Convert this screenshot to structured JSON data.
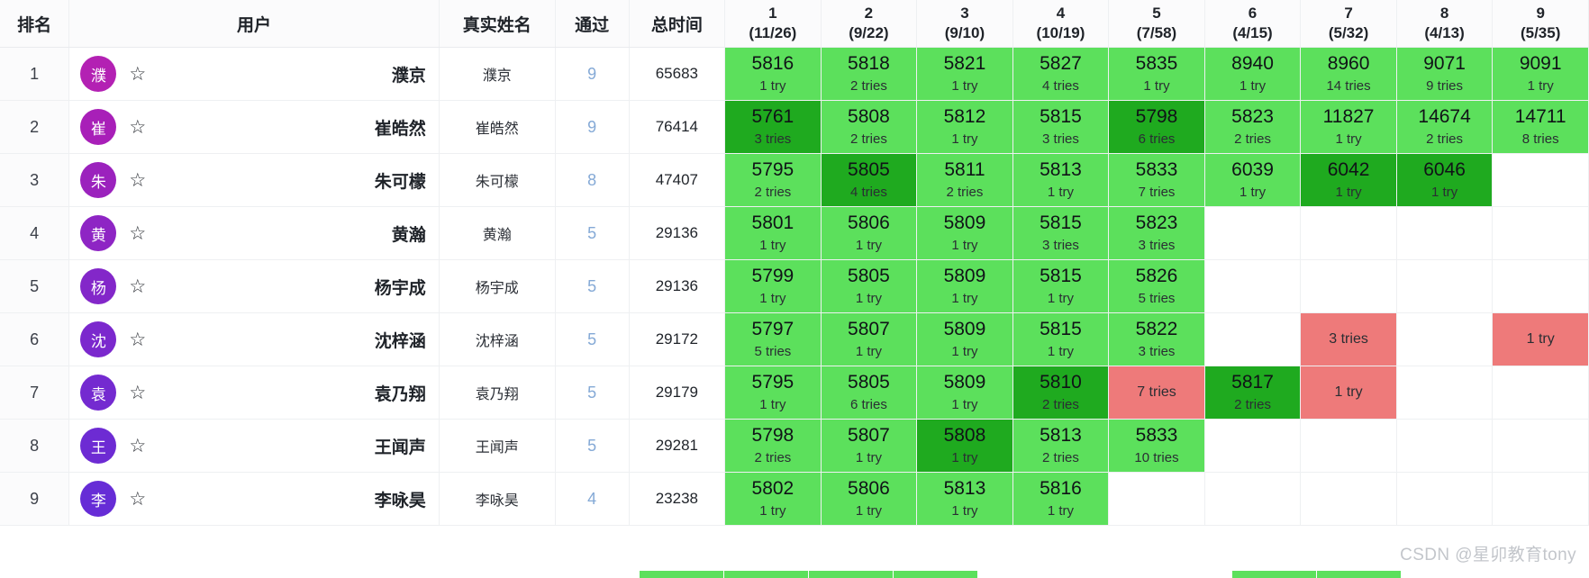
{
  "table": {
    "headers": {
      "rank": "排名",
      "user": "用户",
      "realname": "真实姓名",
      "pass": "通过",
      "total_time": "总时间"
    },
    "problems": [
      {
        "index": "1",
        "ratio": "(11/26)"
      },
      {
        "index": "2",
        "ratio": "(9/22)"
      },
      {
        "index": "3",
        "ratio": "(9/10)"
      },
      {
        "index": "4",
        "ratio": "(10/19)"
      },
      {
        "index": "5",
        "ratio": "(7/58)"
      },
      {
        "index": "6",
        "ratio": "(4/15)"
      },
      {
        "index": "7",
        "ratio": "(5/32)"
      },
      {
        "index": "8",
        "ratio": "(4/13)"
      },
      {
        "index": "9",
        "ratio": "(5/35)"
      }
    ],
    "rows": [
      {
        "rank": "1",
        "avatar_letter": "濮",
        "avatar_color": "#b321b3",
        "username": "濮京",
        "realname": "濮京",
        "pass": "9",
        "total_time": "65683",
        "cells": [
          {
            "state": "solved-first",
            "time": "5816",
            "tries": "1 try"
          },
          {
            "state": "solved-first",
            "time": "5818",
            "tries": "2 tries"
          },
          {
            "state": "solved-first",
            "time": "5821",
            "tries": "1 try"
          },
          {
            "state": "solved-first",
            "time": "5827",
            "tries": "4 tries"
          },
          {
            "state": "solved-first",
            "time": "5835",
            "tries": "1 try"
          },
          {
            "state": "solved-first",
            "time": "8940",
            "tries": "1 try"
          },
          {
            "state": "solved-first",
            "time": "8960",
            "tries": "14 tries"
          },
          {
            "state": "solved-first",
            "time": "9071",
            "tries": "9 tries"
          },
          {
            "state": "solved-first",
            "time": "9091",
            "tries": "1 try"
          }
        ]
      },
      {
        "rank": "2",
        "avatar_letter": "崔",
        "avatar_color": "#a81fb8",
        "username": "崔皓然",
        "realname": "崔皓然",
        "pass": "9",
        "total_time": "76414",
        "cells": [
          {
            "state": "solved-best",
            "time": "5761",
            "tries": "3 tries"
          },
          {
            "state": "solved-first",
            "time": "5808",
            "tries": "2 tries"
          },
          {
            "state": "solved-first",
            "time": "5812",
            "tries": "1 try"
          },
          {
            "state": "solved-first",
            "time": "5815",
            "tries": "3 tries"
          },
          {
            "state": "solved-best",
            "time": "5798",
            "tries": "6 tries"
          },
          {
            "state": "solved-first",
            "time": "5823",
            "tries": "2 tries"
          },
          {
            "state": "solved-first",
            "time": "11827",
            "tries": "1 try"
          },
          {
            "state": "solved-first",
            "time": "14674",
            "tries": "2 tries"
          },
          {
            "state": "solved-first",
            "time": "14711",
            "tries": "8 tries"
          }
        ]
      },
      {
        "rank": "3",
        "avatar_letter": "朱",
        "avatar_color": "#9b22bd",
        "username": "朱可檬",
        "realname": "朱可檬",
        "pass": "8",
        "total_time": "47407",
        "cells": [
          {
            "state": "solved-first",
            "time": "5795",
            "tries": "2 tries"
          },
          {
            "state": "solved-best",
            "time": "5805",
            "tries": "4 tries"
          },
          {
            "state": "solved-first",
            "time": "5811",
            "tries": "2 tries"
          },
          {
            "state": "solved-first",
            "time": "5813",
            "tries": "1 try"
          },
          {
            "state": "solved-first",
            "time": "5833",
            "tries": "7 tries"
          },
          {
            "state": "solved-first",
            "time": "6039",
            "tries": "1 try"
          },
          {
            "state": "solved-best",
            "time": "6042",
            "tries": "1 try"
          },
          {
            "state": "solved-best",
            "time": "6046",
            "tries": "1 try"
          },
          {
            "state": "empty",
            "time": "",
            "tries": ""
          }
        ]
      },
      {
        "rank": "4",
        "avatar_letter": "黄",
        "avatar_color": "#8e25c4",
        "username": "黄瀚",
        "realname": "黄瀚",
        "pass": "5",
        "total_time": "29136",
        "cells": [
          {
            "state": "solved-first",
            "time": "5801",
            "tries": "1 try"
          },
          {
            "state": "solved-first",
            "time": "5806",
            "tries": "1 try"
          },
          {
            "state": "solved-first",
            "time": "5809",
            "tries": "1 try"
          },
          {
            "state": "solved-first",
            "time": "5815",
            "tries": "3 tries"
          },
          {
            "state": "solved-first",
            "time": "5823",
            "tries": "3 tries"
          },
          {
            "state": "empty",
            "time": "",
            "tries": ""
          },
          {
            "state": "empty",
            "time": "",
            "tries": ""
          },
          {
            "state": "empty",
            "time": "",
            "tries": ""
          },
          {
            "state": "empty",
            "time": "",
            "tries": ""
          }
        ]
      },
      {
        "rank": "5",
        "avatar_letter": "杨",
        "avatar_color": "#8327c9",
        "username": "杨宇成",
        "realname": "杨宇成",
        "pass": "5",
        "total_time": "29136",
        "cells": [
          {
            "state": "solved-first",
            "time": "5799",
            "tries": "1 try"
          },
          {
            "state": "solved-first",
            "time": "5805",
            "tries": "1 try"
          },
          {
            "state": "solved-first",
            "time": "5809",
            "tries": "1 try"
          },
          {
            "state": "solved-first",
            "time": "5815",
            "tries": "1 try"
          },
          {
            "state": "solved-first",
            "time": "5826",
            "tries": "5 tries"
          },
          {
            "state": "empty",
            "time": "",
            "tries": ""
          },
          {
            "state": "empty",
            "time": "",
            "tries": ""
          },
          {
            "state": "empty",
            "time": "",
            "tries": ""
          },
          {
            "state": "empty",
            "time": "",
            "tries": ""
          }
        ]
      },
      {
        "rank": "6",
        "avatar_letter": "沈",
        "avatar_color": "#7b28cd",
        "username": "沈梓涵",
        "realname": "沈梓涵",
        "pass": "5",
        "total_time": "29172",
        "cells": [
          {
            "state": "solved-first",
            "time": "5797",
            "tries": "5 tries"
          },
          {
            "state": "solved-first",
            "time": "5807",
            "tries": "1 try"
          },
          {
            "state": "solved-first",
            "time": "5809",
            "tries": "1 try"
          },
          {
            "state": "solved-first",
            "time": "5815",
            "tries": "1 try"
          },
          {
            "state": "solved-first",
            "time": "5822",
            "tries": "3 tries"
          },
          {
            "state": "empty",
            "time": "",
            "tries": ""
          },
          {
            "state": "failed",
            "time": "",
            "tries": "3 tries"
          },
          {
            "state": "empty",
            "time": "",
            "tries": ""
          },
          {
            "state": "failed",
            "time": "",
            "tries": "1 try"
          }
        ]
      },
      {
        "rank": "7",
        "avatar_letter": "袁",
        "avatar_color": "#742ad0",
        "username": "袁乃翔",
        "realname": "袁乃翔",
        "pass": "5",
        "total_time": "29179",
        "cells": [
          {
            "state": "solved-first",
            "time": "5795",
            "tries": "1 try"
          },
          {
            "state": "solved-first",
            "time": "5805",
            "tries": "6 tries"
          },
          {
            "state": "solved-first",
            "time": "5809",
            "tries": "1 try"
          },
          {
            "state": "solved-best",
            "time": "5810",
            "tries": "2 tries"
          },
          {
            "state": "failed",
            "time": "",
            "tries": "7 tries"
          },
          {
            "state": "solved-best",
            "time": "5817",
            "tries": "2 tries"
          },
          {
            "state": "failed",
            "time": "",
            "tries": "1 try"
          },
          {
            "state": "empty",
            "time": "",
            "tries": ""
          },
          {
            "state": "empty",
            "time": "",
            "tries": ""
          }
        ]
      },
      {
        "rank": "8",
        "avatar_letter": "王",
        "avatar_color": "#6d2bd3",
        "username": "王闻声",
        "realname": "王闻声",
        "pass": "5",
        "total_time": "29281",
        "cells": [
          {
            "state": "solved-first",
            "time": "5798",
            "tries": "2 tries"
          },
          {
            "state": "solved-first",
            "time": "5807",
            "tries": "1 try"
          },
          {
            "state": "solved-best",
            "time": "5808",
            "tries": "1 try"
          },
          {
            "state": "solved-first",
            "time": "5813",
            "tries": "2 tries"
          },
          {
            "state": "solved-first",
            "time": "5833",
            "tries": "10 tries"
          },
          {
            "state": "empty",
            "time": "",
            "tries": ""
          },
          {
            "state": "empty",
            "time": "",
            "tries": ""
          },
          {
            "state": "empty",
            "time": "",
            "tries": ""
          },
          {
            "state": "empty",
            "time": "",
            "tries": ""
          }
        ]
      },
      {
        "rank": "9",
        "avatar_letter": "李",
        "avatar_color": "#662cd6",
        "username": "李咏昊",
        "realname": "李咏昊",
        "pass": "4",
        "total_time": "23238",
        "cells": [
          {
            "state": "solved-first",
            "time": "5802",
            "tries": "1 try"
          },
          {
            "state": "solved-first",
            "time": "5806",
            "tries": "1 try"
          },
          {
            "state": "solved-first",
            "time": "5813",
            "tries": "1 try"
          },
          {
            "state": "solved-first",
            "time": "5816",
            "tries": "1 try"
          },
          {
            "state": "empty",
            "time": "",
            "tries": ""
          },
          {
            "state": "empty",
            "time": "",
            "tries": ""
          },
          {
            "state": "empty",
            "time": "",
            "tries": ""
          },
          {
            "state": "empty",
            "time": "",
            "tries": ""
          },
          {
            "state": "empty",
            "time": "",
            "tries": ""
          }
        ]
      }
    ],
    "star_icon": "☆",
    "colors": {
      "solved_first": "#5ce05c",
      "solved_best": "#1faa1f",
      "failed": "#ee7a7a",
      "pass_text": "#84a9d6"
    }
  },
  "watermark": "CSDN @星卯教育tony"
}
